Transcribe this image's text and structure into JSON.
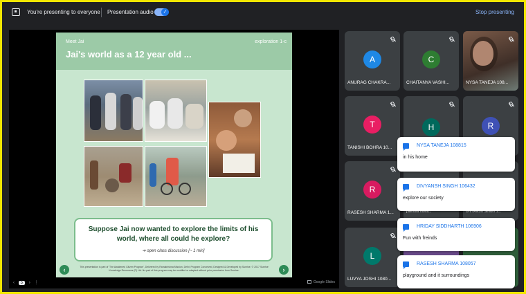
{
  "topbar": {
    "presenting_text": "You're presenting to everyone",
    "audio_label": "Presentation audio",
    "stop_label": "Stop presenting"
  },
  "slide": {
    "kicker": "Meet Jai",
    "tag": "exploration 1-c",
    "title": "Jai's world as a 12 year old ...",
    "question": "Suppose Jai now wanted to explore the limits of his world, where all could he explore?",
    "hint": "➔ open class discussion [~ 1 min]",
    "footnote": "This presentation is part of 'The Awakened Citizen Program', Delivered by Ramakrishna Mission, Delhi; Program Conceived, Designed & Developed by Sunrise. © 2017 Sunrise Knowledge Resources (P) Ltd. No part of this program may be modified or adapted without prior permission from Sunrise.",
    "prev_arrow": "‹",
    "next_arrow": "›"
  },
  "controls": {
    "page_prev": "‹",
    "page_num": "5",
    "page_next": "›",
    "page_more": "⋮",
    "google_slides_label": "Google Slides"
  },
  "participants": [
    {
      "name": "ANURAG CHAKRA...",
      "initial": "A",
      "color": "#1e88e5"
    },
    {
      "name": "CHAITANYA VASHI...",
      "initial": "C",
      "color": "#2e7d32"
    },
    {
      "name": "NYSA TANEJA 108...",
      "initial": "",
      "color": ""
    },
    {
      "name": "TANISHI BOHRA 10...",
      "initial": "T",
      "color": "#e91e63"
    },
    {
      "name": "",
      "initial": "H",
      "color": "#00695c"
    },
    {
      "name": "",
      "initial": "R",
      "color": "#3f51b5"
    },
    {
      "name": "RASESH SHARMA 1...",
      "initial": "R",
      "color": "#d81b60"
    },
    {
      "name": "LUVYA JOSHI 1080...",
      "initial": "L",
      "color": "#00796b"
    }
  ],
  "hidden_labels": {
    "behind_1": "paendra mona...",
    "behind_2": "DIVYANSH SINGH 1..."
  },
  "chat": [
    {
      "name": "NYSA TANEJA 108815",
      "message": "in his home"
    },
    {
      "name": "DIVYANSH SINGH 106432",
      "message": "explore our society"
    },
    {
      "name": "HRIDAY SIDDHARTH 106906",
      "message": "Fun with freinds"
    },
    {
      "name": "RASESH SHARMA 108057",
      "message": "playground and it surroundings"
    }
  ],
  "colors": {
    "background": "#202124",
    "accent": "#8ab4f8",
    "slide_green": "#9ccaa7",
    "border": "#f2e600"
  }
}
